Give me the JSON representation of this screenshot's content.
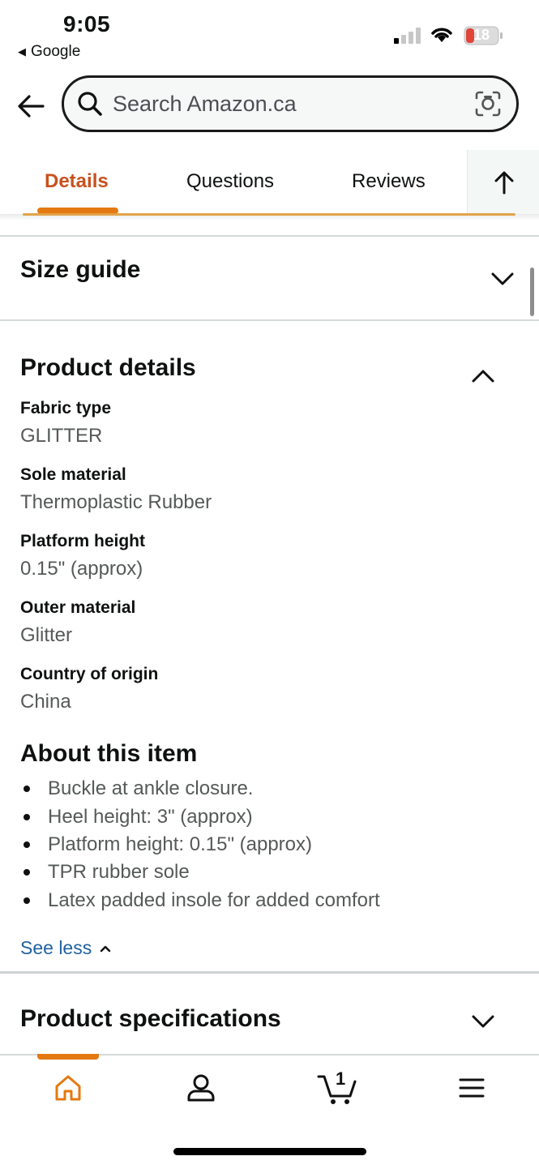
{
  "status_bar": {
    "time": "9:05",
    "back_app": "Google",
    "battery": "18",
    "battery_color": "#e0453a",
    "icons": [
      "signal-icon",
      "wifi-icon",
      "battery-icon"
    ]
  },
  "search": {
    "placeholder": "Search Amazon.ca",
    "icons": [
      "back-arrow-icon",
      "search-icon",
      "camera-lens-icon"
    ]
  },
  "tabs": [
    {
      "label": "Details",
      "active": true
    },
    {
      "label": "Questions",
      "active": false
    },
    {
      "label": "Reviews",
      "active": false
    }
  ],
  "accent_color": "#e47911",
  "size_guide": {
    "title": "Size guide",
    "expanded": false
  },
  "product_details": {
    "title": "Product details",
    "expanded": true,
    "rows": [
      {
        "label": "Fabric type",
        "value": "GLITTER"
      },
      {
        "label": "Sole material",
        "value": "Thermoplastic Rubber"
      },
      {
        "label": "Platform height",
        "value": "0.15\" (approx)"
      },
      {
        "label": "Outer material",
        "value": "Glitter"
      },
      {
        "label": "Country of origin",
        "value": "China"
      }
    ]
  },
  "about": {
    "title": "About this item",
    "bullets": [
      "Buckle at ankle closure.",
      "Heel height: 3\" (approx)",
      "Platform height: 0.15\" (approx)",
      "TPR rubber sole",
      "Latex padded insole for added comfort"
    ],
    "see_less": "See less"
  },
  "product_specifications": {
    "title": "Product specifications",
    "expanded": false
  },
  "bottom_nav": {
    "items": [
      "home-icon",
      "account-icon",
      "cart-icon",
      "menu-icon"
    ],
    "active": "home-icon",
    "cart_count": "1"
  }
}
